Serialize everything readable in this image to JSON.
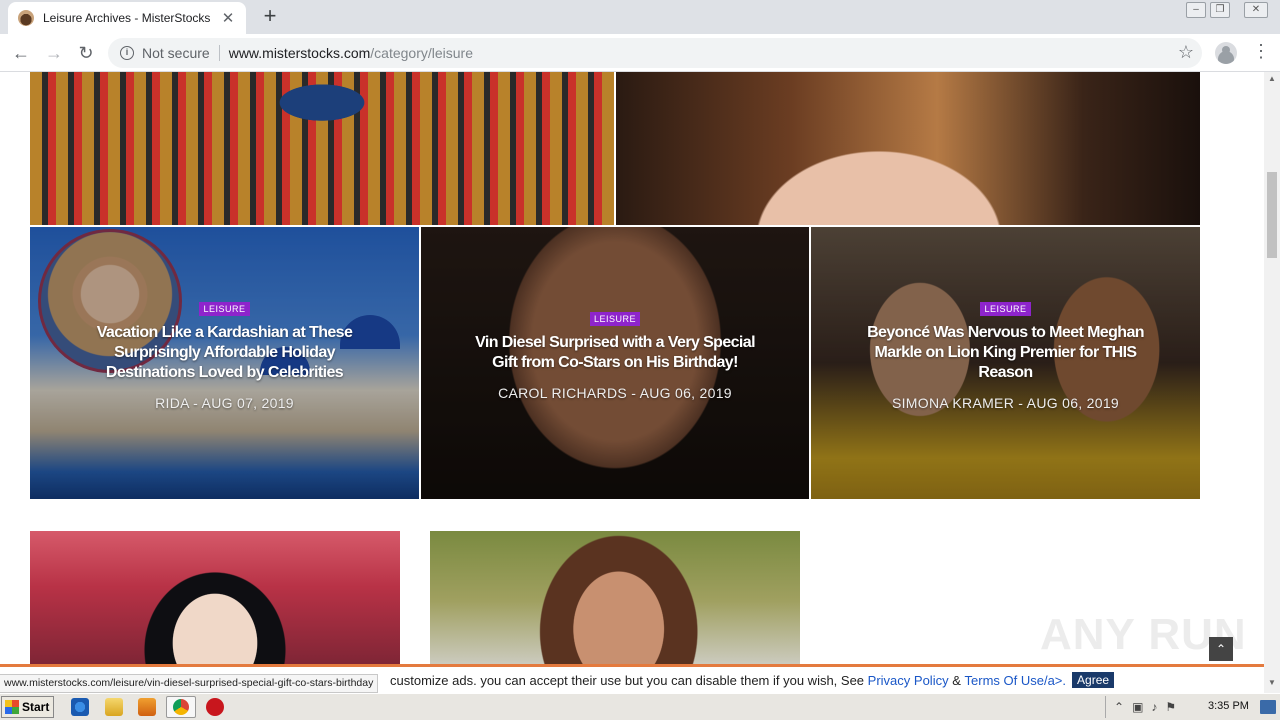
{
  "browser": {
    "tab_title": "Leisure Archives - MisterStocks",
    "tab_close": "✕",
    "new_tab": "+",
    "security_label": "Not secure",
    "url_host": "www.misterstocks.com",
    "url_path": "/category/leisure"
  },
  "cards": [
    {
      "category": "LEISURE",
      "title": "Vacation Like a Kardashian at These Surprisingly Affordable Holiday Destinations Loved by Celebrities",
      "meta": "RIDA - AUG 07, 2019"
    },
    {
      "category": "LEISURE",
      "title": "Vin Diesel Surprised with a Very Special Gift from Co-Stars on His Birthday!",
      "meta": "CAROL RICHARDS - AUG 06, 2019"
    },
    {
      "category": "LEISURE",
      "title": "Beyoncé Was Nervous to Meet Meghan Markle on Lion King Premier for THIS Reason",
      "meta": "SIMONA KRAMER - AUG 06, 2019"
    }
  ],
  "status_url": "www.misterstocks.com/leisure/vin-diesel-surprised-special-gift-co-stars-birthday",
  "cookie": {
    "text": "customize ads. you can accept their use but you can disable them if you wish, See",
    "privacy_link": "Privacy Policy",
    "amp": "&",
    "terms_link": "Terms Of Use/a>.",
    "agree": "Agree"
  },
  "watermark": "ANY RUN",
  "taskbar": {
    "start": "Start",
    "clock": "3:35 PM"
  }
}
